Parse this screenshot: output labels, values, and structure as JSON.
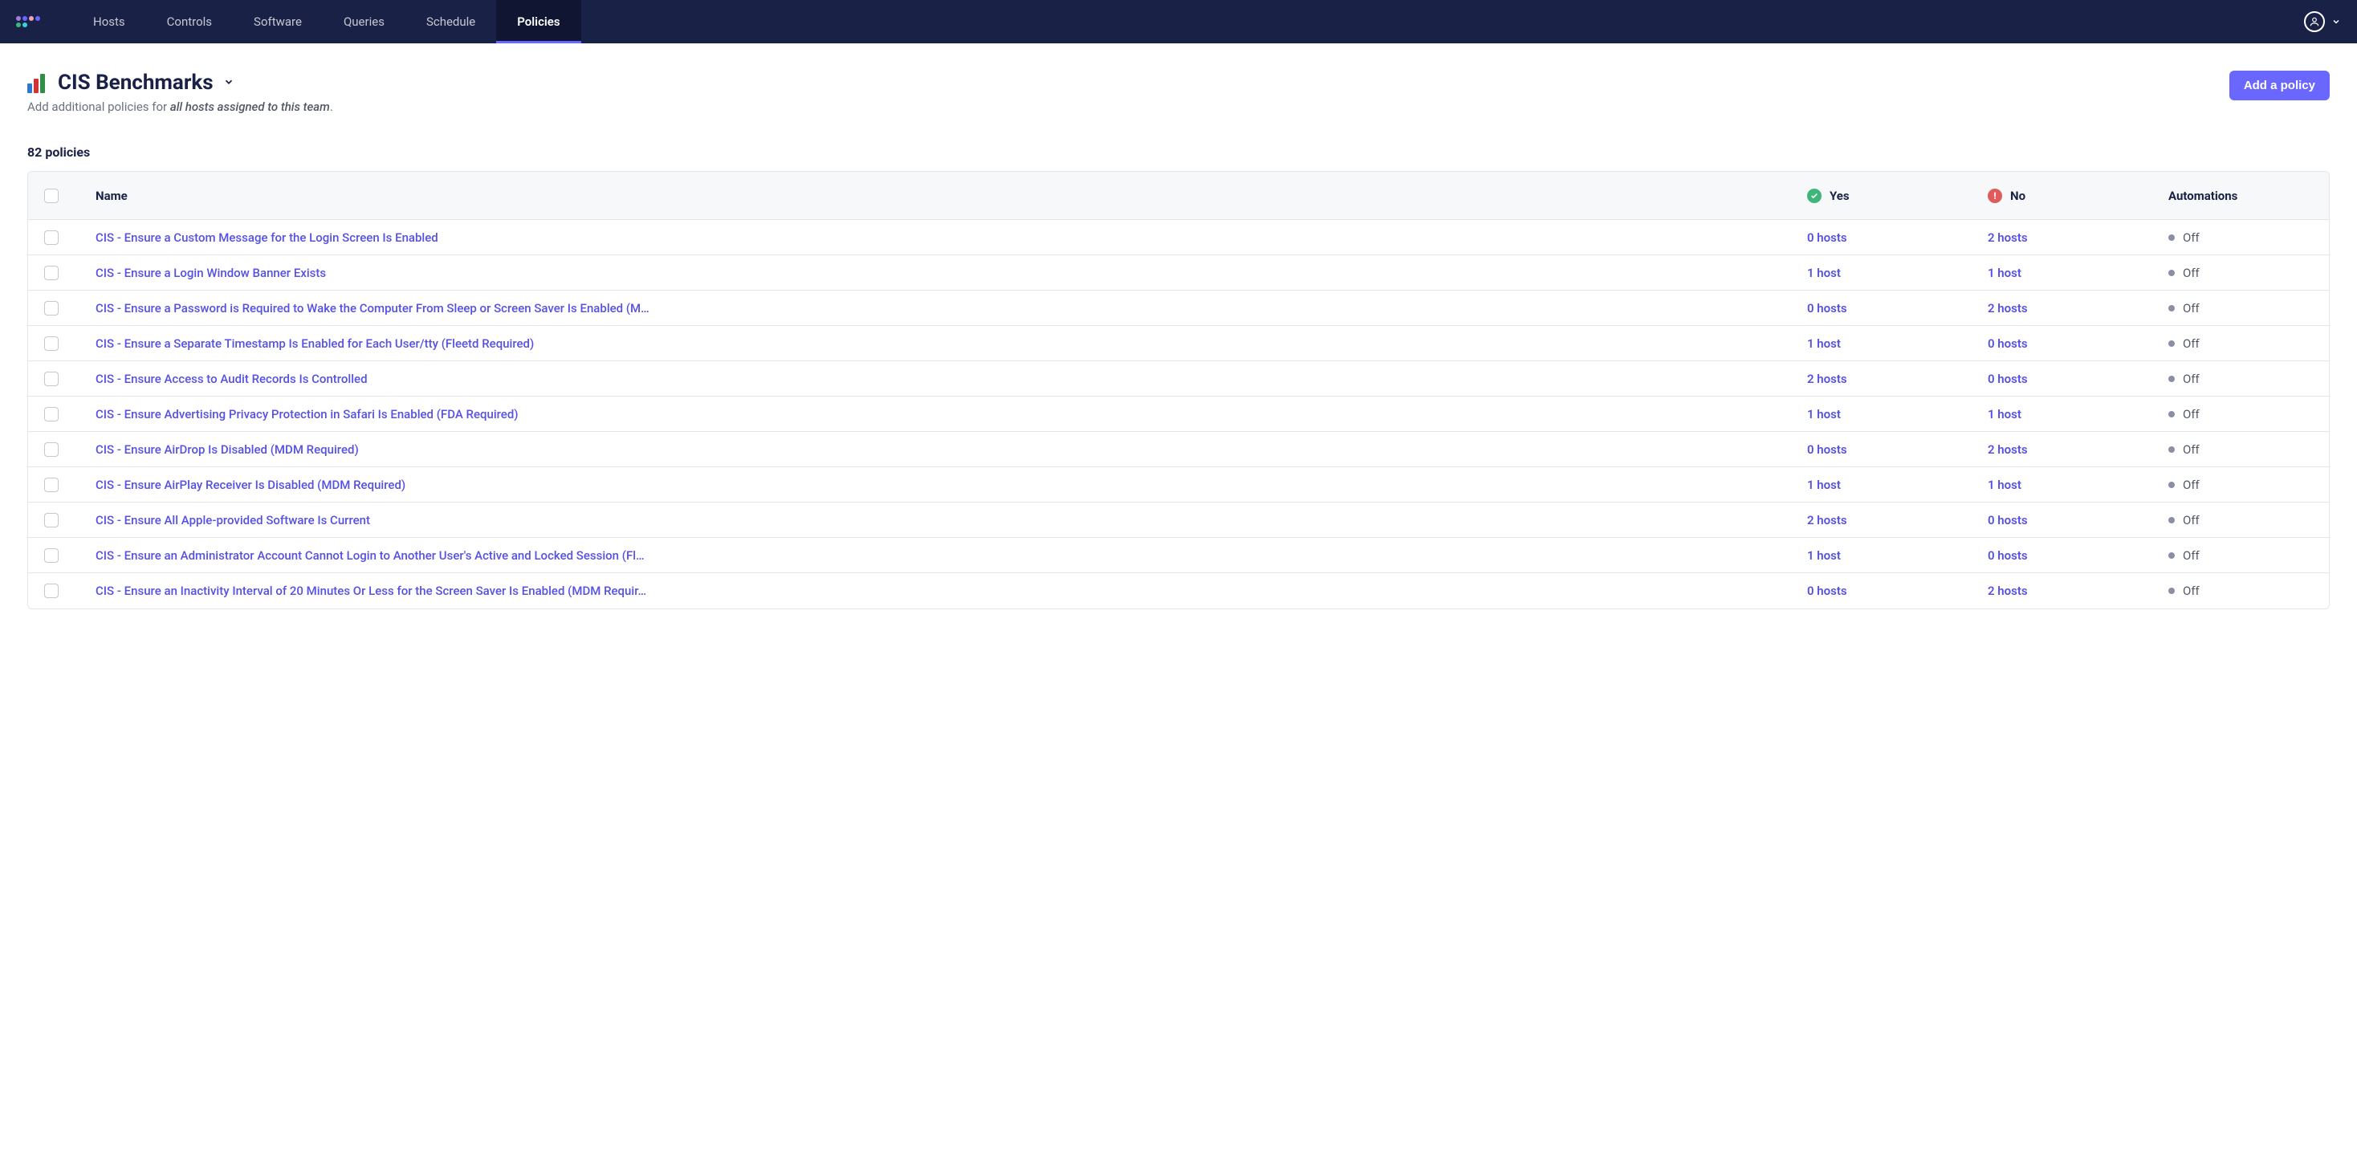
{
  "nav": {
    "items": [
      "Hosts",
      "Controls",
      "Software",
      "Queries",
      "Schedule",
      "Policies"
    ],
    "active": "Policies"
  },
  "header": {
    "title": "CIS Benchmarks",
    "subtitle_prefix": "Add additional policies for ",
    "subtitle_em": "all hosts assigned to this team",
    "subtitle_suffix": ".",
    "add_button": "Add a policy"
  },
  "count_label": "82 policies",
  "columns": {
    "name": "Name",
    "yes": "Yes",
    "no": "No",
    "automations": "Automations"
  },
  "rows": [
    {
      "name": "CIS - Ensure a Custom Message for the Login Screen Is Enabled",
      "yes": "0 hosts",
      "no": "2 hosts",
      "automation": "Off"
    },
    {
      "name": "CIS - Ensure a Login Window Banner Exists",
      "yes": "1 host",
      "no": "1 host",
      "automation": "Off"
    },
    {
      "name": "CIS - Ensure a Password is Required to Wake the Computer From Sleep or Screen Saver Is Enabled (M…",
      "yes": "0 hosts",
      "no": "2 hosts",
      "automation": "Off"
    },
    {
      "name": "CIS - Ensure a Separate Timestamp Is Enabled for Each User/tty (Fleetd Required)",
      "yes": "1 host",
      "no": "0 hosts",
      "automation": "Off"
    },
    {
      "name": "CIS - Ensure Access to Audit Records Is Controlled",
      "yes": "2 hosts",
      "no": "0 hosts",
      "automation": "Off"
    },
    {
      "name": "CIS - Ensure Advertising Privacy Protection in Safari Is Enabled (FDA Required)",
      "yes": "1 host",
      "no": "1 host",
      "automation": "Off"
    },
    {
      "name": "CIS - Ensure AirDrop Is Disabled (MDM Required)",
      "yes": "0 hosts",
      "no": "2 hosts",
      "automation": "Off"
    },
    {
      "name": "CIS - Ensure AirPlay Receiver Is Disabled (MDM Required)",
      "yes": "1 host",
      "no": "1 host",
      "automation": "Off"
    },
    {
      "name": "CIS - Ensure All Apple-provided Software Is Current",
      "yes": "2 hosts",
      "no": "0 hosts",
      "automation": "Off"
    },
    {
      "name": "CIS - Ensure an Administrator Account Cannot Login to Another User's Active and Locked Session (Fl…",
      "yes": "1 host",
      "no": "0 hosts",
      "automation": "Off"
    },
    {
      "name": "CIS - Ensure an Inactivity Interval of 20 Minutes Or Less for the Screen Saver Is Enabled (MDM Requir…",
      "yes": "0 hosts",
      "no": "2 hosts",
      "automation": "Off"
    }
  ],
  "logo_colors": [
    "#a07dd8",
    "#6a67fe",
    "#f3a0b8",
    "#6a67fe",
    "#3db67a",
    "#3ccedb"
  ]
}
